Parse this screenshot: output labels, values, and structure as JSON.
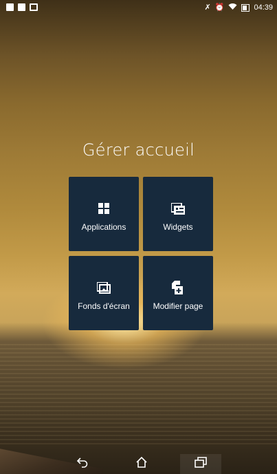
{
  "status_bar": {
    "time": "04:39",
    "left_icons": [
      "notification-icon",
      "sd-card-icon",
      "image-icon"
    ],
    "right_icons": [
      "mute-icon",
      "alarm-icon",
      "wifi-icon",
      "battery-icon"
    ]
  },
  "home_manager": {
    "title": "Gérer accueil",
    "tiles": [
      {
        "label": "Applications",
        "icon": "grid-apps-icon"
      },
      {
        "label": "Widgets",
        "icon": "widgets-icon"
      },
      {
        "label": "Fonds d'écran",
        "icon": "wallpaper-icon"
      },
      {
        "label": "Modifier page",
        "icon": "edit-page-icon"
      }
    ]
  },
  "nav_bar": {
    "buttons": [
      "back-icon",
      "home-icon",
      "recent-apps-icon"
    ]
  },
  "colors": {
    "tile_background": "#172a3d",
    "text": "#ffffff"
  }
}
